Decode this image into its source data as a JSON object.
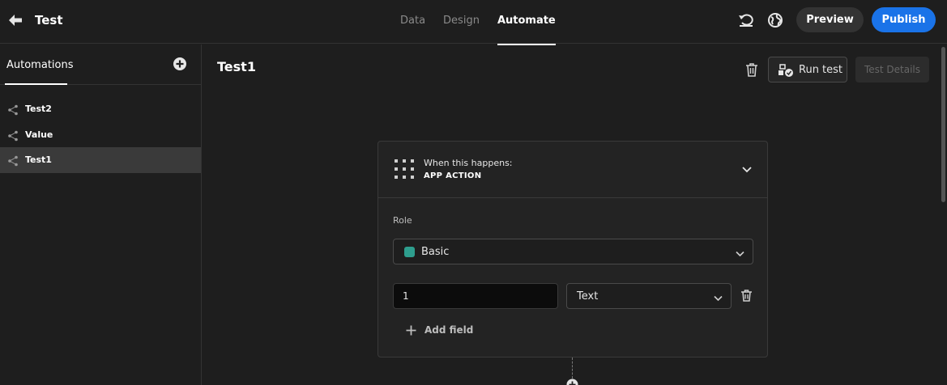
{
  "header": {
    "app_title": "Test",
    "tabs": [
      {
        "label": "Data"
      },
      {
        "label": "Design"
      },
      {
        "label": "Automate"
      }
    ],
    "preview_label": "Preview",
    "publish_label": "Publish",
    "icons": [
      "back-arrow-icon",
      "revert-icon",
      "globe-icon"
    ]
  },
  "sidebar": {
    "title": "Automations",
    "items": [
      {
        "label": "Test2"
      },
      {
        "label": "Value"
      },
      {
        "label": "Test1"
      }
    ]
  },
  "main": {
    "title": "Test1",
    "run_test_label": "Run test",
    "test_details_label": "Test Details",
    "trigger": {
      "when_label": "When this happens:",
      "type_label": "APP ACTION",
      "role_label": "Role",
      "role_value": "Basic",
      "role_color": "#2e9e8e",
      "field_key": "1",
      "field_type": "Text",
      "add_field_label": "Add field"
    }
  },
  "colors": {
    "accent": "#1a73e8",
    "background": "#1e1e1e"
  }
}
